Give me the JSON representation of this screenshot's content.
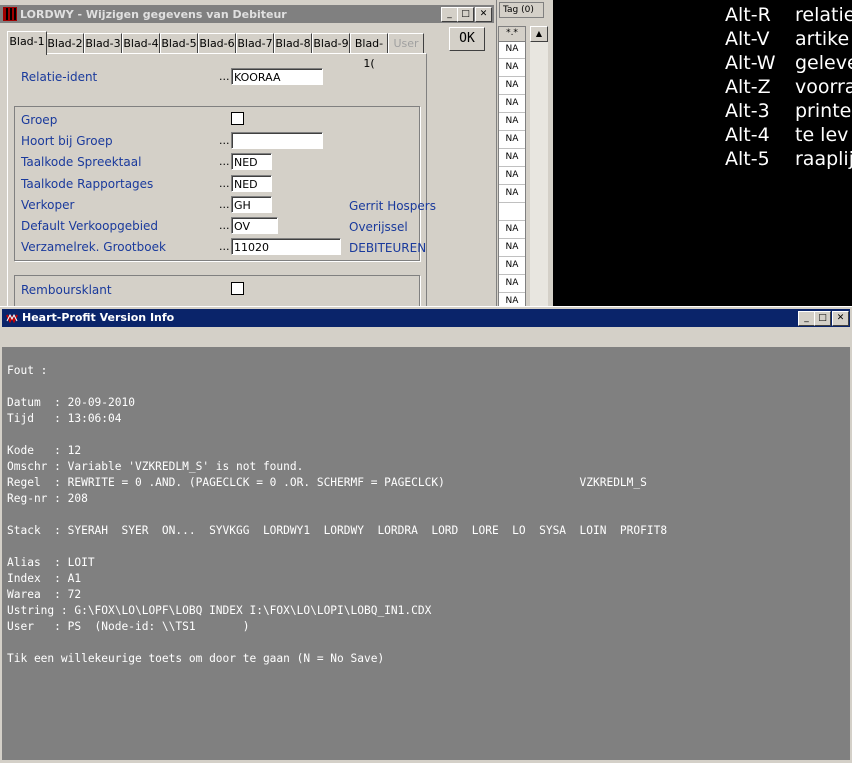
{
  "terminal": {
    "shortcuts": [
      {
        "key": "Alt-R",
        "label": "relatie"
      },
      {
        "key": "Alt-V",
        "label": "artike"
      },
      {
        "key": "Alt-W",
        "label": "geleve"
      },
      {
        "key": "Alt-Z",
        "label": "voorra"
      },
      {
        "key": "Alt-3",
        "label": "printe"
      },
      {
        "key": "Alt-4",
        "label": "te lev"
      },
      {
        "key": "Alt-5",
        "label": "raaplij"
      }
    ]
  },
  "tags": {
    "header": "Tag (0)",
    "star": "*.*",
    "cells": [
      "NA",
      "NA",
      "NA",
      "NA",
      "NA",
      "NA",
      "NA",
      "NA",
      "NA",
      "",
      "NA",
      "NA",
      "NA",
      "NA",
      "NA"
    ]
  },
  "dialog": {
    "title": "LORDWY - Wijzigen gegevens van Debiteur",
    "controls": {
      "minimize": "_",
      "maximize": "□",
      "close": "✕"
    },
    "tabs": [
      "Blad-1",
      "Blad-2",
      "Blad-3",
      "Blad-4",
      "Blad-5",
      "Blad-6",
      "Blad-7",
      "Blad-8",
      "Blad-9",
      "Blad-1(",
      "User"
    ],
    "ok_label": "OK",
    "fields": {
      "relatie_ident": {
        "label": "Relatie-ident",
        "value": "KOORAA"
      },
      "groep": {
        "label": "Groep"
      },
      "hoort_bij_groep": {
        "label": "Hoort bij Groep",
        "value": ""
      },
      "taalkode_spreektaal": {
        "label": "Taalkode Spreektaal",
        "value": "NED"
      },
      "taalkode_rapportages": {
        "label": "Taalkode Rapportages",
        "value": "NED"
      },
      "verkoper": {
        "label": "Verkoper",
        "value": "GH",
        "desc": "Gerrit Hospers"
      },
      "default_verkoopgebied": {
        "label": "Default Verkoopgebied",
        "value": "OV",
        "desc": "Overijssel"
      },
      "verzamelrek": {
        "label": "Verzamelrek. Grootboek",
        "value": "11020",
        "desc": "DEBITEUREN"
      },
      "remboursklant": {
        "label": "Remboursklant"
      }
    },
    "dots": "..."
  },
  "info": {
    "title": "Heart-Profit Version Info",
    "lines": [
      "Fout :",
      "",
      "Datum  : 20-09-2010",
      "Tijd   : 13:06:04",
      "",
      "Kode   : 12",
      "Omschr : Variable 'VZKREDLM_S' is not found.",
      "Regel  : REWRITE = 0 .AND. (PAGECLCK = 0 .OR. SCHERMF = PAGECLCK)                    VZKREDLM_S",
      "Reg-nr : 208",
      "",
      "Stack  : SYERAH  SYER  ON...  SYVKGG  LORDWY1  LORDWY  LORDRA  LORD  LORE  LO  SYSA  LOIN  PROFIT8",
      "",
      "Alias  : LOIT",
      "Index  : A1",
      "Warea  : 72",
      "Ustring : G:\\FOX\\LO\\LOPF\\LOBQ INDEX I:\\FOX\\LO\\LOPI\\LOBQ_IN1.CDX",
      "User   : PS  (Node-id: \\\\TS1       )",
      "",
      "Tik een willekeurige toets om door te gaan (N = No Save)"
    ]
  }
}
